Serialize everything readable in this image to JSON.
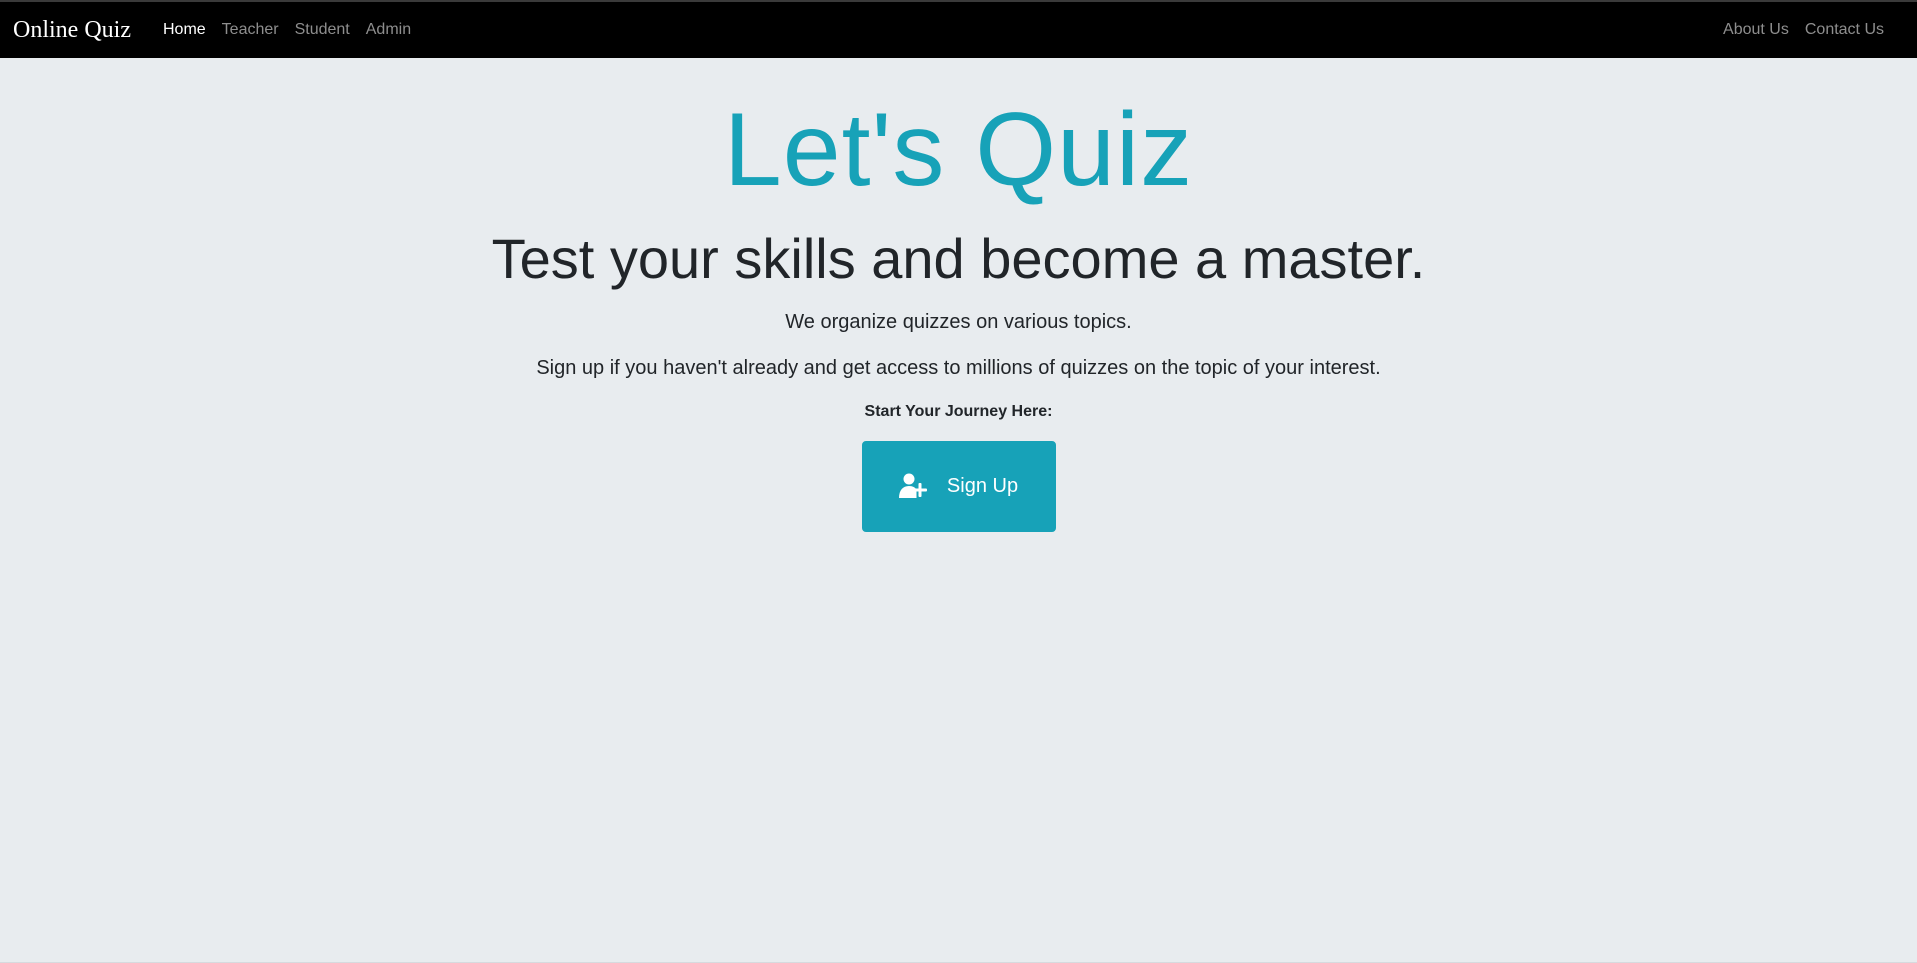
{
  "navbar": {
    "brand": "Online Quiz",
    "links": [
      {
        "label": "Home",
        "active": true
      },
      {
        "label": "Teacher",
        "active": false
      },
      {
        "label": "Student",
        "active": false
      },
      {
        "label": "Admin",
        "active": false
      }
    ],
    "right_links": [
      {
        "label": "About Us"
      },
      {
        "label": "Contact Us"
      }
    ]
  },
  "hero": {
    "title": "Let's Quiz",
    "subtitle": "Test your skills and become a master.",
    "lead_1": "We organize quizzes on various topics.",
    "lead_2": "Sign up if you haven't already and get access to millions of quizzes on the topic of your interest.",
    "journey_label": "Start Your Journey Here:",
    "signup_button": {
      "label": "Sign Up",
      "icon": "user-plus-icon"
    }
  },
  "colors": {
    "accent": "#17a2b8",
    "navbar_bg": "#000000",
    "page_bg": "#e8ecef",
    "text": "#212529",
    "nav_inactive": "#8e8e8e"
  }
}
